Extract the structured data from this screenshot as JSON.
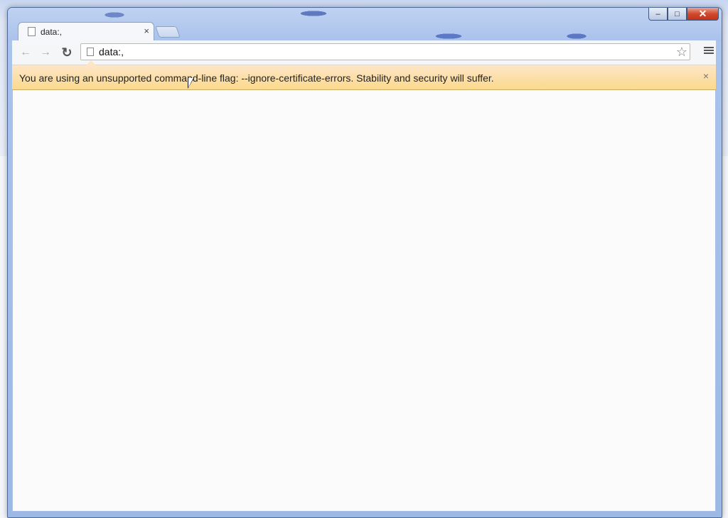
{
  "window": {
    "controls": {
      "minimize": "–",
      "maximize": "□",
      "close": "✕"
    }
  },
  "tabs": [
    {
      "title": "data:,",
      "close": "×"
    }
  ],
  "toolbar": {
    "back_icon": "←",
    "forward_icon": "→",
    "reload_icon": "↻",
    "url": "data:,",
    "bookmark_icon": "☆"
  },
  "infobar": {
    "message": "You are using an unsupported command-line flag: --ignore-certificate-errors. Stability and security will suffer.",
    "close": "×"
  }
}
